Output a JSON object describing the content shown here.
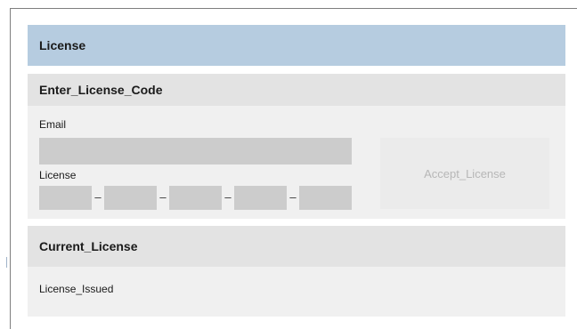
{
  "panel": {
    "title": "License"
  },
  "enter_license": {
    "title": "Enter_License_Code",
    "email_label": "Email",
    "email_value": "",
    "license_label": "License",
    "license_segments": [
      "",
      "",
      "",
      "",
      ""
    ],
    "separator": "–",
    "accept_label": "Accept_License"
  },
  "current_license": {
    "title": "Current_License",
    "issued_label": "License_Issued"
  }
}
